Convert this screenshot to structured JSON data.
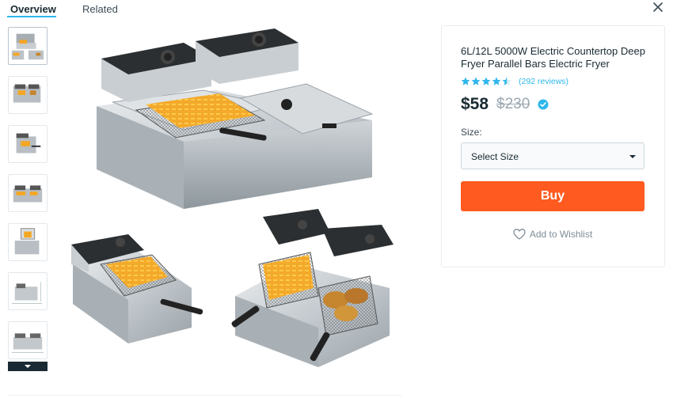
{
  "tabs": {
    "overview_label": "Overview",
    "related_label": "Related"
  },
  "close_icon": "close-icon",
  "thumbnails": {
    "count": 7,
    "active_index": 0,
    "more_icon": "chevron-down-icon"
  },
  "product": {
    "title": "6L/12L 5000W Electric Countertop Deep Fryer Parallel Bars Electric Fryer",
    "rating": 4.5,
    "rating_max": 5,
    "reviews_text": "(292 reviews)",
    "price": "$58",
    "original_price": "$230",
    "verified_icon": "check-badge-icon",
    "size_label": "Size:",
    "size_select_value": "Select Size",
    "buy_label": "Buy",
    "wishlist_label": "Add to Wishlist",
    "wishlist_icon": "heart-icon"
  },
  "colors": {
    "accent_blue": "#2fb7ec",
    "buy_orange": "#ff5a1f",
    "text_dark": "#192a32",
    "muted": "#9aa7b0"
  }
}
